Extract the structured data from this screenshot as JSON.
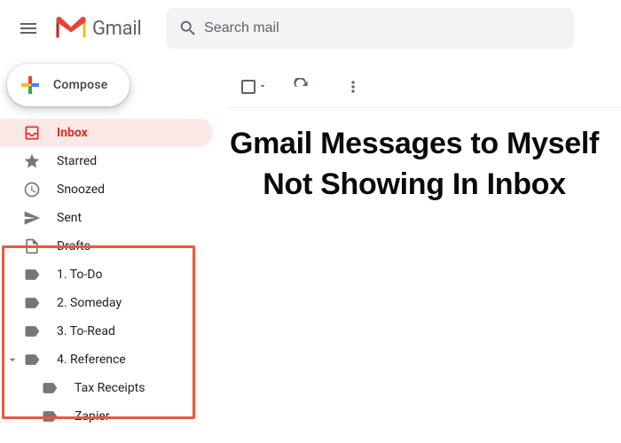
{
  "brand": {
    "name": "Gmail"
  },
  "search": {
    "placeholder": "Search mail"
  },
  "compose": {
    "label": "Compose"
  },
  "sidebar": {
    "items": [
      {
        "label": "Inbox"
      },
      {
        "label": "Starred"
      },
      {
        "label": "Snoozed"
      },
      {
        "label": "Sent"
      },
      {
        "label": "Drafts"
      },
      {
        "label": "1. To-Do"
      },
      {
        "label": "2. Someday"
      },
      {
        "label": "3. To-Read"
      },
      {
        "label": "4. Reference"
      },
      {
        "label": "Tax Receipts"
      },
      {
        "label": "Zapier"
      }
    ]
  },
  "headline": "Gmail Messages to Myself Not Showing In Inbox"
}
